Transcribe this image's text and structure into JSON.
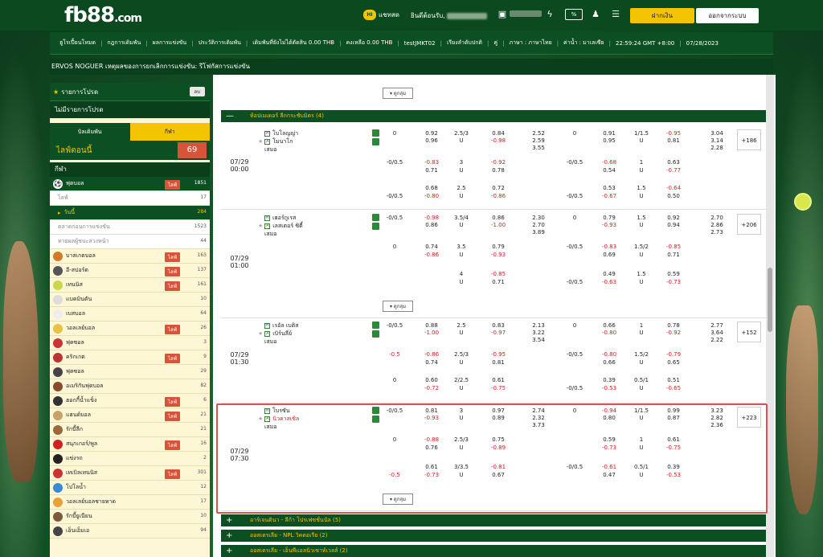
{
  "header": {
    "logo": "fb88",
    "logo_suffix": ".com",
    "chat_badge": "HI",
    "chat_label": "แชทสด",
    "welcome": "ยินดีต้อนรับ,",
    "deposit": "ฝากเงิน",
    "logout": "ออกจากระบบ",
    "icons": [
      "user-card-icon",
      "wallet-icon",
      "lightning-icon",
      "promo-icon",
      "person-icon",
      "checklist-icon"
    ]
  },
  "nav": {
    "items": [
      "ฮูโรเปี้ยนโหมด",
      "กฎการเดิมพัน",
      "ผลการแข่งขัน",
      "ประวัติการเดิมพัน",
      "เดิมพันที่ยังไม่ได้ตัดสิน 0.00 THB",
      "คงเหลือ 0.00 THB",
      "testJMKT02",
      "เรียงลำดับปกติ",
      "คู่",
      "ภาษา : ภาษาไทย",
      "ค่าน้ำ : มาเลเซีย",
      "22:59:24 GMT +8:00",
      "07/28/2023"
    ]
  },
  "ticker": "ERVOS NOGUER เหตุผลของการยกเลิกการแข่งขัน: รีโฟกัสการแข่งขัน",
  "sidebar": {
    "promo_title": "รายการโปรด",
    "promo_btn": "ลบ",
    "promo_none": "ไม่มีรายการโปรด",
    "tab_bet": "บิลเดิมพัน",
    "tab_sport": "กีฬา",
    "live_now": "ไลฟ์ตอนนี้",
    "live_count": "69",
    "sports_title": "กีฬา",
    "live_tag": "ไลฟ์",
    "soccer": {
      "label": "ฟุตบอล",
      "count": "1851"
    },
    "sub": [
      {
        "label": "ไลฟ์",
        "count": "17"
      },
      {
        "label": "วันนี้",
        "count": "284"
      },
      {
        "label": "ตลาดก่อนการแข่งขัน",
        "count": "1523"
      },
      {
        "label": "ทายผลผู้ชนะล่วงหน้า",
        "count": "44"
      }
    ],
    "sports": [
      {
        "label": "บาสเกตบอล",
        "count": "163",
        "live": true,
        "color": "#d07a2a"
      },
      {
        "label": "อี-สปอร์ต",
        "count": "137",
        "live": true,
        "color": "#555"
      },
      {
        "label": "เทนนิส",
        "count": "161",
        "live": true,
        "color": "#c8d84a"
      },
      {
        "label": "แบดมินตัน",
        "count": "10",
        "live": false,
        "color": "#ddd"
      },
      {
        "label": "เบสบอล",
        "count": "64",
        "live": false,
        "color": "#eee"
      },
      {
        "label": "วอลเลย์บอล",
        "count": "26",
        "live": true,
        "color": "#e8c04a"
      },
      {
        "label": "ฟุตซอล",
        "count": "3",
        "live": false,
        "color": "#c33"
      },
      {
        "label": "คริกเกต",
        "count": "9",
        "live": true,
        "color": "#b33"
      },
      {
        "label": "ฟุตซอล",
        "count": "29",
        "live": false,
        "color": "#444"
      },
      {
        "label": "อเมริกันฟุตบอล",
        "count": "82",
        "live": false,
        "color": "#8a4a2a"
      },
      {
        "label": "ฮอกกี้น้ำแข็ง",
        "count": "6",
        "live": true,
        "color": "#333"
      },
      {
        "label": "แฮนด์บอล",
        "count": "21",
        "live": true,
        "color": "#c8a06a"
      },
      {
        "label": "รักบี้ลีก",
        "count": "21",
        "live": false,
        "color": "#9a6a3a"
      },
      {
        "label": "สนุกเกอร์/พูล",
        "count": "16",
        "live": true,
        "color": "#c22"
      },
      {
        "label": "แข่งรถ",
        "count": "2",
        "live": false,
        "color": "#222"
      },
      {
        "label": "เทเบิลเทนนิส",
        "count": "301",
        "live": true,
        "color": "#c33"
      },
      {
        "label": "โปโลน้ำ",
        "count": "12",
        "live": false,
        "color": "#3a8ad8"
      },
      {
        "label": "วอลเลย์บอลชายหาด",
        "count": "17",
        "live": false,
        "color": "#e8a03a"
      },
      {
        "label": "รักบี้ยูเนียน",
        "count": "10",
        "live": false,
        "color": "#7a5a3a"
      },
      {
        "label": "เอ็นเอ็มเอ",
        "count": "94",
        "live": false,
        "color": "#444"
      }
    ]
  },
  "main": {
    "expand": "ดูกลุ่ม",
    "league1": "ห้อปเมเดอร์ ลีกกระชับมิตร (4)",
    "matches": [
      {
        "date": "07/29",
        "time": "00:00",
        "home": "โบโลญญ่า",
        "away": "โมนาโก",
        "draw": "เสมอ",
        "more": "+186",
        "rows": [
          [
            "0",
            "0.92",
            "2.5/3",
            "0.84",
            "2.52",
            "0",
            "0.91",
            "1/1.5",
            "-0.95",
            "3.04"
          ],
          [
            "",
            "0.96",
            "U",
            "-0.98",
            "2.59",
            "",
            "0.95",
            "U",
            "0.81",
            "3.14"
          ],
          [
            "",
            "",
            "",
            "",
            "3.55",
            "",
            "",
            "",
            "",
            "2.28"
          ]
        ],
        "rows2": [
          [
            "-0/0.5",
            "-0.83",
            "3",
            "-0.92",
            "-0/0.5",
            "-0.68",
            "1",
            "0.63"
          ],
          [
            "",
            "0.71",
            "U",
            "0.78",
            "",
            "0.54",
            "U",
            "-0.77"
          ]
        ],
        "rows3": [
          [
            "",
            "0.68",
            "2.5",
            "0.72",
            "",
            "0.53",
            "1.5",
            "-0.64"
          ],
          [
            "-0/0.5",
            "-0.80",
            "U",
            "-0.86",
            "-0/0.5",
            "-0.67",
            "U",
            "0.50"
          ]
        ]
      },
      {
        "date": "07/29",
        "time": "01:00",
        "home": "เฮอร์กูเรส",
        "away": "เลสเตอร์ ซิตี้",
        "draw": "เสมอ",
        "more": "+206",
        "rows": [
          [
            "-0/0.5",
            "-0.98",
            "3.5/4",
            "0.86",
            "2.30",
            "0",
            "0.79",
            "1.5",
            "0.92",
            "2.70"
          ],
          [
            "",
            "0.86",
            "U",
            "-1.00",
            "2.70",
            "",
            "-0.93",
            "U",
            "0.94",
            "2.86"
          ],
          [
            "",
            "",
            "",
            "",
            "3.89",
            "",
            "",
            "",
            "",
            "2.73"
          ]
        ],
        "rows2": [
          [
            "0",
            "0.74",
            "3.5",
            "0.79",
            "-0/0.5",
            "-0.83",
            "1.5/2",
            "-0.85"
          ],
          [
            "",
            "-0.86",
            "U",
            "-0.93",
            "",
            "0.69",
            "U",
            "0.71"
          ]
        ],
        "rows3": [
          [
            "",
            "",
            "4",
            "-0.85",
            "",
            "0.49",
            "1.5",
            "0.59"
          ],
          [
            "",
            "",
            "U",
            "0.71",
            "-0/0.5",
            "-0.63",
            "U",
            "-0.73"
          ]
        ]
      },
      {
        "date": "07/29",
        "time": "01:30",
        "home": "เรอัล เบติส",
        "away": "เบิร์นลี่ย์",
        "draw": "เสมอ",
        "more": "+152",
        "rows": [
          [
            "-0/0.5",
            "0.88",
            "2.5",
            "0.83",
            "2.13",
            "0",
            "0.66",
            "1",
            "0.78",
            "2.77"
          ],
          [
            "",
            "-1.00",
            "U",
            "-0.97",
            "3.22",
            "",
            "-0.80",
            "U",
            "-0.92",
            "3.64"
          ],
          [
            "",
            "",
            "",
            "",
            "3.54",
            "",
            "",
            "",
            "",
            "2.22"
          ]
        ],
        "rows2": [
          [
            "-0.5",
            "-0.86",
            "2.5/3",
            "-0.95",
            "-0/0.5",
            "-0.80",
            "1.5/2",
            "-0.79"
          ],
          [
            "",
            "0.74",
            "U",
            "0.81",
            "",
            "0.66",
            "U",
            "0.65"
          ]
        ],
        "rows3": [
          [
            "0",
            "0.60",
            "2/2.5",
            "0.61",
            "",
            "0.39",
            "0.5/1",
            "0.51"
          ],
          [
            "",
            "-0.72",
            "U",
            "-0.75",
            "-0/0.5",
            "-0.53",
            "U",
            "-0.65"
          ]
        ]
      },
      {
        "date": "07/29",
        "time": "07:30",
        "home": "โบรซัน",
        "away": "นิวคาสเซิล",
        "draw": "เสมอ",
        "more": "+223",
        "rows": [
          [
            "-0/0.5",
            "0.81",
            "3",
            "0.97",
            "2.74",
            "0",
            "-0.94",
            "1/1.5",
            "0.99",
            "3.23"
          ],
          [
            "",
            "-0.93",
            "U",
            "0.89",
            "2.32",
            "",
            "0.80",
            "U",
            "0.87",
            "2.82"
          ],
          [
            "",
            "",
            "",
            "",
            "3.73",
            "",
            "",
            "",
            "",
            "2.36"
          ]
        ],
        "rows2": [
          [
            "0",
            "-0.88",
            "2.5/3",
            "0.75",
            "",
            "0.59",
            "1",
            "0.61"
          ],
          [
            "",
            "0.76",
            "U",
            "-0.89",
            "",
            "-0.73",
            "U",
            "-0.75"
          ]
        ],
        "rows3": [
          [
            "",
            "0.61",
            "3/3.5",
            "-0.81",
            "-0/0.5",
            "-0.61",
            "0.5/1",
            "0.39"
          ],
          [
            "-0.5",
            "-0.73",
            "U",
            "0.67",
            "",
            "0.47",
            "U",
            "-0.53"
          ]
        ]
      }
    ],
    "bottom_leagues": [
      "อาร์เจนตินา - ลีก้า โปรเฟซชั่นนัล (5)",
      "ออสเตรเลีย - NPL วิคตอเรีย (2)",
      "ออสเตรเลีย - เอ็นพีแอลนิวเซาท์เวลส์ (2)"
    ]
  }
}
